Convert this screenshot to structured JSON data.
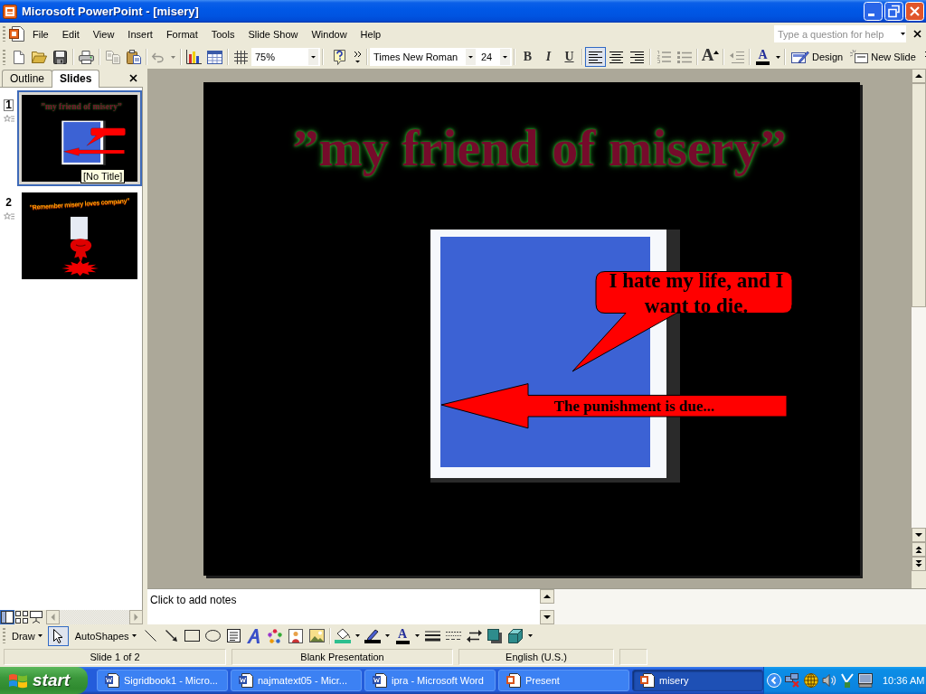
{
  "window": {
    "title": "Microsoft PowerPoint - [misery]"
  },
  "menu_bar": {
    "items": [
      "File",
      "Edit",
      "View",
      "Insert",
      "Format",
      "Tools",
      "Slide Show",
      "Window",
      "Help"
    ],
    "help_box": {
      "placeholder": "Type a question for help"
    }
  },
  "toolbar": {
    "copy": {
      "disabled": true
    },
    "undo": {
      "disabled": true
    },
    "zoom": {
      "value": "75%"
    },
    "font": {
      "value": "Times New Roman"
    },
    "font_size": {
      "value": "24"
    },
    "style_buttons": [
      {
        "label": "B",
        "selected": false
      },
      {
        "label": "I",
        "selected": false
      },
      {
        "label": "U",
        "selected": false
      }
    ],
    "align_buttons": [
      {
        "selected": true
      },
      {
        "selected": false
      },
      {
        "selected": false
      }
    ],
    "list_buttons": [
      {
        "disabled": true
      },
      {
        "disabled": true
      }
    ],
    "grow_font": {
      "label": "A"
    },
    "decrease_indent": {
      "disabled": true
    },
    "font_color": {
      "label": "A"
    },
    "design": {
      "label": "Design"
    },
    "new_slide": {
      "label": "New Slide"
    }
  },
  "outline_pane": {
    "tabs": [
      {
        "label": "Outline",
        "selected": false
      },
      {
        "label": "Slides",
        "selected": true
      }
    ],
    "slides": [
      {
        "number": "1",
        "selected": true,
        "kind": "callouts",
        "title": "”my friend of misery”",
        "tooltip": "[No Title]"
      },
      {
        "number": "2",
        "selected": false,
        "kind": "burst",
        "title": "”Remember misery loves company”"
      }
    ],
    "view_buttons": [
      {
        "selected": true
      },
      {
        "selected": false
      },
      {
        "selected": false
      }
    ]
  },
  "slide": {
    "title": "”my friend of misery”",
    "callout": "I hate my life, and I want to die.",
    "arrow_label": "The punishment is due..."
  },
  "notes": {
    "placeholder": "Click to add notes"
  },
  "drawing_toolbar": {
    "draw_menu": {
      "label": "Draw"
    },
    "select_tool": {
      "selected": true
    },
    "autoshapes_menu": {
      "label": "AutoShapes"
    },
    "font_color": {
      "label": "A"
    }
  },
  "status_bar": [
    "Slide 1 of 2",
    "Blank Presentation",
    "English (U.S.)"
  ],
  "taskbar": {
    "start": "start",
    "tasks": [
      {
        "label": "Sigridbook1 - Micro...",
        "kind": "document",
        "selected": false
      },
      {
        "label": "najmatext05 - Micr...",
        "kind": "document",
        "selected": false
      },
      {
        "label": "ipra - Microsoft Word",
        "kind": "document",
        "selected": false
      },
      {
        "label": "Present",
        "kind": "presentation",
        "selected": false
      },
      {
        "label": "misery",
        "kind": "presentation",
        "selected": true
      }
    ],
    "clock": "10:36 AM"
  }
}
